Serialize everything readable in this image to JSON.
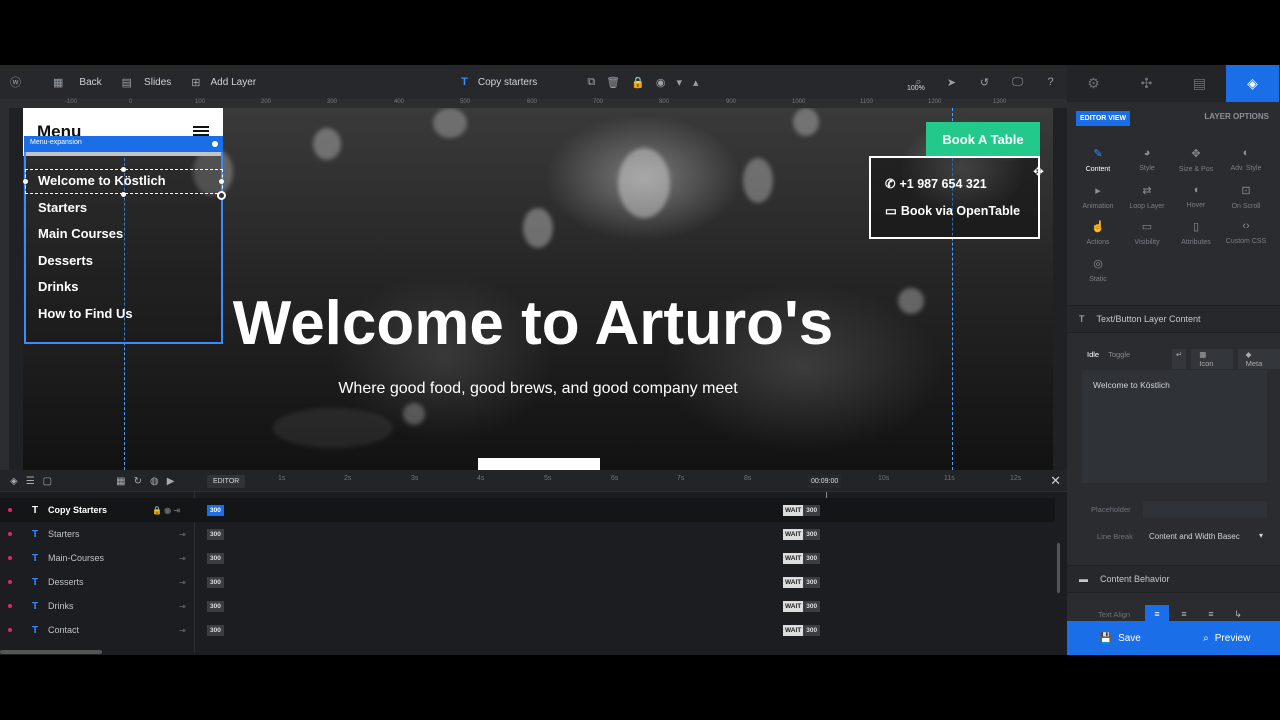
{
  "toolbar": {
    "back": "Back",
    "slides": "Slides",
    "add_layer": "Add Layer",
    "layer_name": "Copy starters",
    "zoom": "100%"
  },
  "ruler": [
    "-100",
    "0",
    "100",
    "200",
    "300",
    "400",
    "500",
    "600",
    "700",
    "800",
    "900",
    "1000",
    "1100",
    "1200",
    "1300"
  ],
  "slide": {
    "menu_title": "Menu",
    "menu_tag": "Menu-expansion",
    "menu_items": [
      "Welcome to Köstlich",
      "Starters",
      "Main Courses",
      "Desserts",
      "Drinks",
      "How to Find Us"
    ],
    "book_button": "Book A Table",
    "phone": "+1 987 654 321",
    "opentable": "Book via OpenTable",
    "title": "Welcome to Arturo's",
    "subtitle": "Where good food, good brews, and good company meet"
  },
  "timeline": {
    "editor": "EDITOR",
    "ticks": [
      "1s",
      "2s",
      "3s",
      "4s",
      "5s",
      "6s",
      "7s",
      "8s",
      "10s",
      "11s",
      "12s"
    ],
    "current_time": "00:09:00",
    "wait": "WAIT",
    "rows": [
      {
        "label": "Copy Starters",
        "start": "300",
        "end": "300"
      },
      {
        "label": "Starters",
        "start": "300",
        "end": "300"
      },
      {
        "label": "Main-Courses",
        "start": "300",
        "end": "300"
      },
      {
        "label": "Desserts",
        "start": "300",
        "end": "300"
      },
      {
        "label": "Drinks",
        "start": "300",
        "end": "300"
      },
      {
        "label": "Contact",
        "start": "300",
        "end": "300"
      }
    ]
  },
  "panel": {
    "editor_view": "EDITOR VIEW",
    "layer_options": "LAYER OPTIONS",
    "options": [
      {
        "label": "Content",
        "icon": "pencil-icon"
      },
      {
        "label": "Style",
        "icon": "palette-icon"
      },
      {
        "label": "Size & Pos",
        "icon": "move-icon"
      },
      {
        "label": "Adv. Style",
        "icon": "drop-icon"
      },
      {
        "label": "Animation",
        "icon": "play-icon"
      },
      {
        "label": "Loop Layer",
        "icon": "loop-icon"
      },
      {
        "label": "Hover",
        "icon": "mouse-icon"
      },
      {
        "label": "On Scroll",
        "icon": "scroll-icon"
      },
      {
        "label": "Actions",
        "icon": "hand-icon"
      },
      {
        "label": "Visibility",
        "icon": "eye-icon"
      },
      {
        "label": "Attributes",
        "icon": "file-icon"
      },
      {
        "label": "Custom CSS",
        "icon": "code-icon"
      },
      {
        "label": "Static",
        "icon": "circle-icon"
      }
    ],
    "section_text": "Text/Button Layer Content",
    "idle": "Idle",
    "toggle": "Toggle",
    "icon_btn": "Icon",
    "meta_btn": "Meta",
    "text_value": "Welcome to Köstlich",
    "placeholder_label": "Placeholder",
    "line_break_label": "Line Break",
    "line_break_value": "Content and Width Basec",
    "section_behavior": "Content Behavior",
    "text_align_label": "Text Align",
    "save": "Save",
    "preview": "Preview"
  }
}
